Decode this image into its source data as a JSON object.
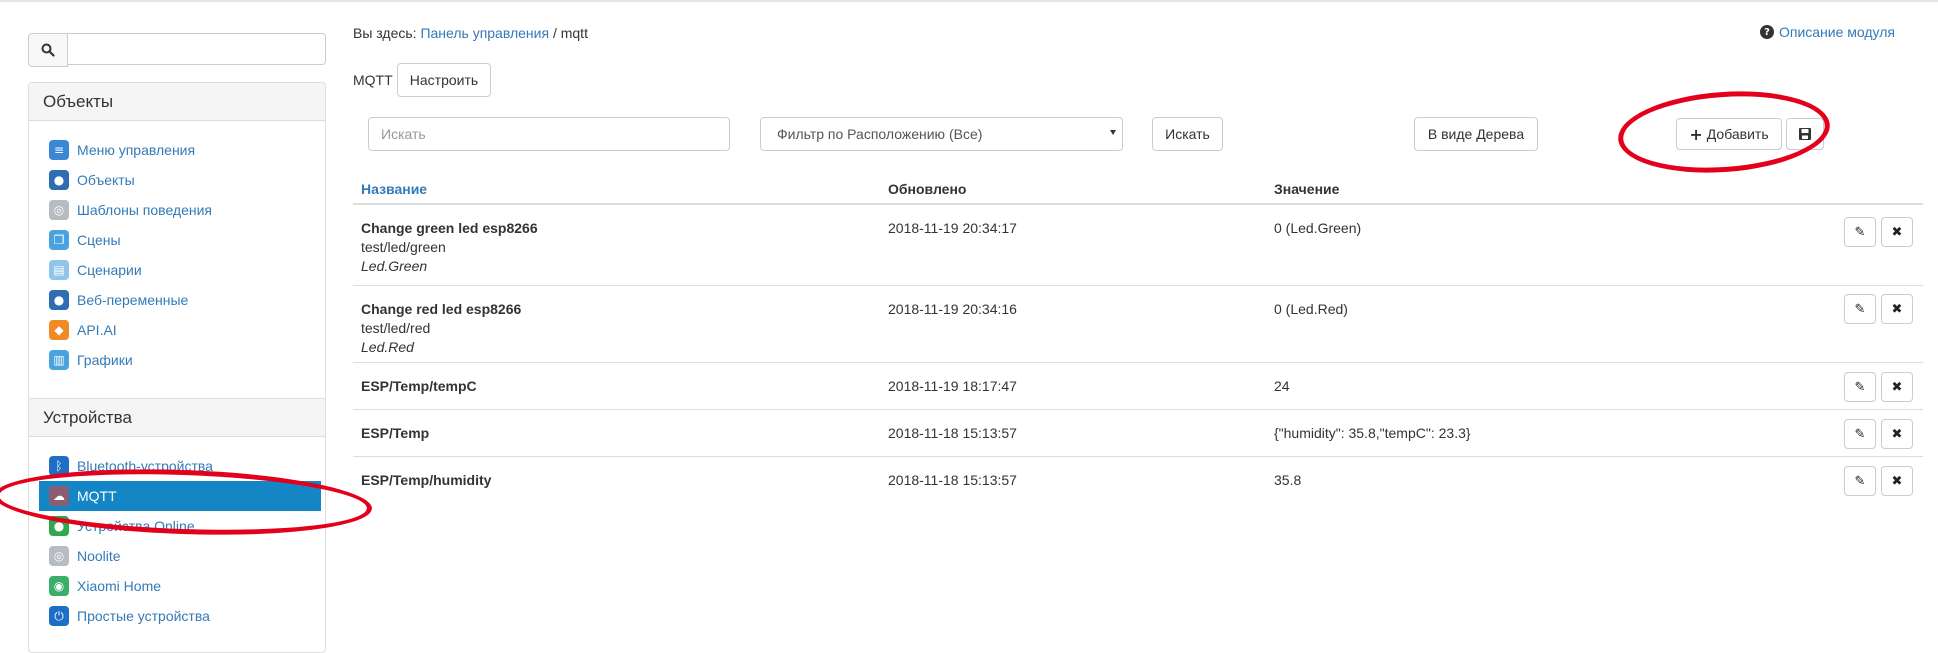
{
  "sidebar": {
    "search": {
      "placeholder": ""
    },
    "objects_panel": {
      "title": "Объекты",
      "items": [
        {
          "label": "Меню управления",
          "icon": "menu-icon",
          "color": "#3a87d6"
        },
        {
          "label": "Объекты",
          "icon": "globe-icon",
          "color": "#2e6db3"
        },
        {
          "label": "Шаблоны поведения",
          "icon": "template-icon",
          "color": "#b7bcc2"
        },
        {
          "label": "Сцены",
          "icon": "scenes-icon",
          "color": "#4aa3df"
        },
        {
          "label": "Сценарии",
          "icon": "script-icon",
          "color": "#8fc5ea"
        },
        {
          "label": "Веб-переменные",
          "icon": "globe-web-icon",
          "color": "#2e6db3"
        },
        {
          "label": "API.AI",
          "icon": "box-icon",
          "color": "#f08a24"
        },
        {
          "label": "Графики",
          "icon": "chart-icon",
          "color": "#4aa3df"
        }
      ]
    },
    "devices_panel": {
      "title": "Устройства",
      "items": [
        {
          "label": "Bluetooth-устройства",
          "icon": "bluetooth-icon",
          "color": "#1c6fc4"
        },
        {
          "label": "MQTT",
          "icon": "cloud-icon",
          "color": "#8a5d73",
          "active": true
        },
        {
          "label": "Устройства Online",
          "icon": "online-icon",
          "color": "#2fa84f"
        },
        {
          "label": "Noolite",
          "icon": "noolite-icon",
          "color": "#b7bcc2"
        },
        {
          "label": "Xiaomi Home",
          "icon": "xiaomi-icon",
          "color": "#3cae6b"
        },
        {
          "label": "Простые устройства",
          "icon": "power-icon",
          "color": "#1c6fc4"
        }
      ]
    }
  },
  "breadcrumb": {
    "prefix": "Вы здесь:",
    "home": "Панель управления",
    "separator": "/",
    "current": "mqtt"
  },
  "help_link": "Описание модуля",
  "module": {
    "title": "MQTT",
    "configure_label": "Настроить"
  },
  "toolbar": {
    "search_placeholder": "Искать",
    "location_filter": "Фильтр по Расположению (Все)",
    "search_button": "Искать",
    "tree_button": "В виде Дерева",
    "add_button": "Добавить"
  },
  "table": {
    "headers": [
      "Название",
      "Обновлено",
      "Значение"
    ],
    "rows": [
      {
        "name": "Change green led esp8266",
        "topic": "test/led/green",
        "link": "Led.Green",
        "updated": "2018-11-19 20:34:17",
        "value": "0 (Led.Green)"
      },
      {
        "name": "Change red led esp8266",
        "topic": "test/led/red",
        "link": "Led.Red",
        "updated": "2018-11-19 20:34:16",
        "value": "0 (Led.Red)"
      },
      {
        "name": "ESP/Temp/tempC",
        "topic": "",
        "link": "",
        "updated": "2018-11-19 18:17:47",
        "value": "24"
      },
      {
        "name": "ESP/Temp",
        "topic": "",
        "link": "",
        "updated": "2018-11-18 15:13:57",
        "value": "{\"humidity\": 35.8,\"tempC\": 23.3}"
      },
      {
        "name": "ESP/Temp/humidity",
        "topic": "",
        "link": "",
        "updated": "2018-11-18 15:13:57",
        "value": "35.8"
      }
    ]
  },
  "colors": {
    "accent": "#337ab7",
    "active": "#1486c6",
    "annotation": "#e3001b"
  }
}
